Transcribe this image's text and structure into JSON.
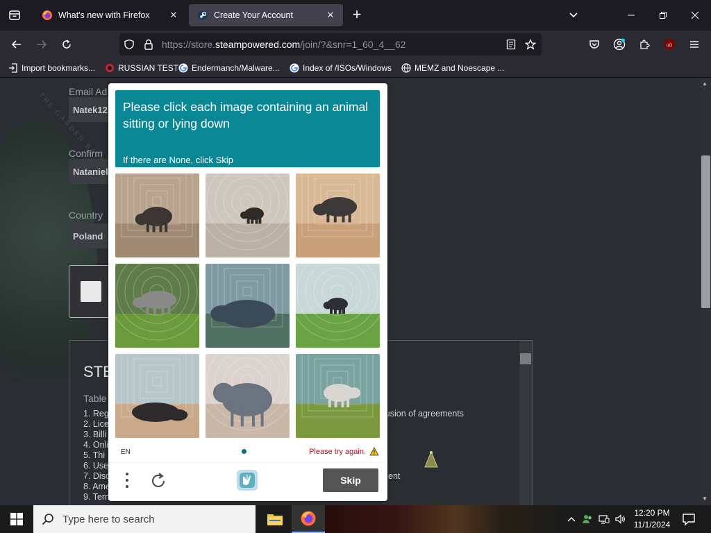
{
  "browser": {
    "tabs": [
      {
        "title": "What's new with Firefox",
        "active": false
      },
      {
        "title": "Create Your Account",
        "active": true
      }
    ],
    "url": {
      "prefix": "https://store.",
      "host": "steampowered.com",
      "path": "/join/?&snr=1_60_4__62"
    },
    "bookmarks": [
      "Import bookmarks...",
      "RUSSIAN TEST",
      "Endermanch/Malware...",
      "Index of /ISOs/Windows",
      "MEMZ and Noescape ..."
    ]
  },
  "page": {
    "email_label": "Email Ad",
    "email_value": "Natek12",
    "confirm_label": "Confirm",
    "confirm_value": "Nataniel",
    "country_label": "Country",
    "country_value": "Poland",
    "bg_text": "THE GARDEN BETWEEN",
    "agreement": {
      "heading": "STE",
      "toc_title": "Table",
      "items": [
        "1. Reg",
        "2. Lice",
        "3. Billi",
        "4. Onli",
        "5. Thi",
        "6. Use",
        "7. Disc",
        "8. Ame",
        "9. Tern"
      ],
      "fragment_1": "lusion of agreements",
      "fragment_2": "ent"
    }
  },
  "captcha": {
    "prompt": "Please click each image containing an animal sitting or lying down",
    "subprompt": "If there are None, click Skip",
    "language": "EN",
    "error": "Please try again.",
    "skip_label": "Skip",
    "images": [
      {
        "subject": "rhino walking",
        "bg": "#b8a38e",
        "ground": "#a08a74",
        "animal": "#3b3533"
      },
      {
        "subject": "small rhino walking",
        "bg": "#cfc6bd",
        "ground": "#bcb1a5",
        "animal": "#2f2b29"
      },
      {
        "subject": "rhino walking",
        "bg": "#d8b896",
        "ground": "#c8a07a",
        "animal": "#3c3a38"
      },
      {
        "subject": "rhino in forest",
        "bg": "#5f7c4a",
        "ground": "#6a9a3c",
        "animal": "#8a8a88"
      },
      {
        "subject": "rhino lying down",
        "bg": "#7f9aa2",
        "ground": "#4f6e62",
        "animal": "#3b4a58"
      },
      {
        "subject": "rhino running",
        "bg": "#c8d8d8",
        "ground": "#6aa246",
        "animal": "#2e3036"
      },
      {
        "subject": "rhino lying down",
        "bg": "#b7c7c9",
        "ground": "#c9a98a",
        "animal": "#2c2a2a"
      },
      {
        "subject": "rhino standing",
        "bg": "#ddd3ce",
        "ground": "#c9b7a8",
        "animal": "#6b7280"
      },
      {
        "subject": "rhino standing",
        "bg": "#7aa3a0",
        "ground": "#7b9a3f",
        "animal": "#d8d6d0"
      }
    ]
  },
  "taskbar": {
    "search_placeholder": "Type here to search",
    "time": "12:20 PM",
    "date": "11/1/2024"
  },
  "colors": {
    "prompt_bg": "#0a8794",
    "error_text": "#b3091c",
    "skip_bg": "#555555",
    "firefox_dark": "#1c1b22",
    "firefox_toolbar": "#2b2a33"
  }
}
